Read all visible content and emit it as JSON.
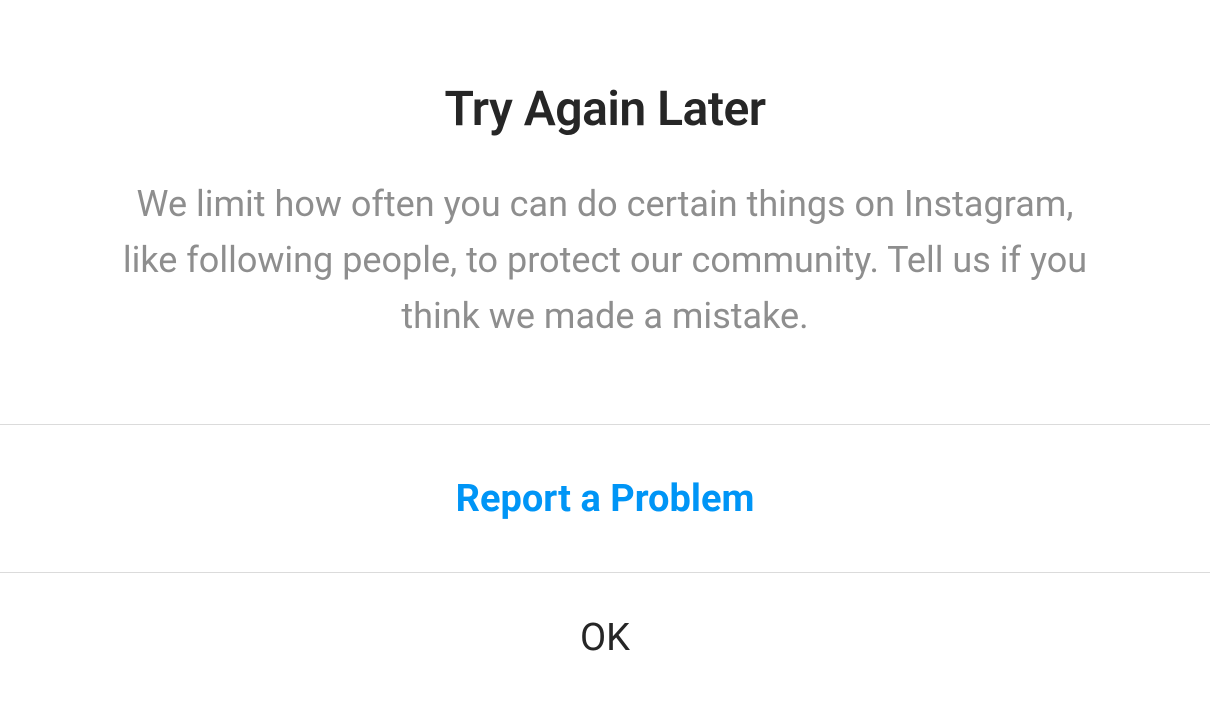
{
  "dialog": {
    "title": "Try Again Later",
    "message": "We limit how often you can do certain things on Instagram, like following people, to protect our community. Tell us if you think we made a mistake.",
    "report_label": "Report a Problem",
    "ok_label": "OK"
  }
}
